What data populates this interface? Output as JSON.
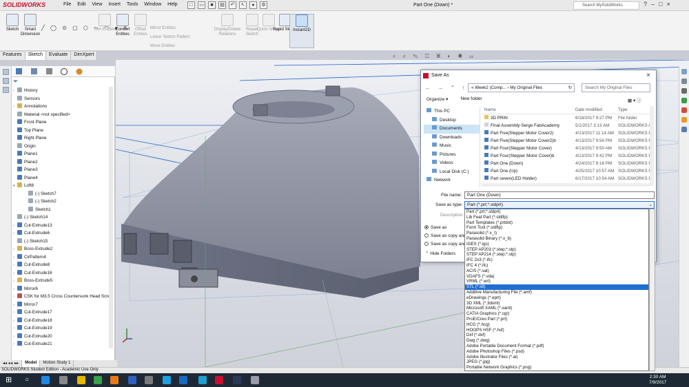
{
  "app": {
    "logo": "SOLIDWORKS",
    "menu": [
      "File",
      "Edit",
      "View",
      "Insert",
      "Tools",
      "Window",
      "Help"
    ],
    "document_title": "Part One (Down) *",
    "search_placeholder": "Search MySolidWorks"
  },
  "ribbon": {
    "tools": [
      {
        "label": "Sketch",
        "dim": false
      },
      {
        "label": "Smart Dimension",
        "dim": false
      },
      {
        "label": "Trim Entities",
        "dim": true
      },
      {
        "label": "Convert Entities",
        "dim": false
      },
      {
        "label": "Offset Entities",
        "dim": true
      },
      {
        "label": "Display/Delete Relations",
        "dim": true
      },
      {
        "label": "Repair Sketch",
        "dim": true
      },
      {
        "label": "Quick Snaps",
        "dim": true
      },
      {
        "label": "Rapid Sketch",
        "dim": false
      },
      {
        "label": "Instant2D",
        "dim": false
      }
    ],
    "mirror": "Mirror Entities",
    "linear": "Linear Sketch Pattern",
    "move": "Move Entities"
  },
  "command_tabs": [
    "Features",
    "Sketch",
    "Evaluate",
    "DimXpert"
  ],
  "tree": [
    {
      "label": "History",
      "icon": "gray"
    },
    {
      "label": "Sensors",
      "icon": "gray"
    },
    {
      "label": "Annotations",
      "icon": "yel"
    },
    {
      "label": "Material <not specified>",
      "icon": "gray"
    },
    {
      "label": "Front Plane",
      "icon": "blue"
    },
    {
      "label": "Top Plane",
      "icon": "blue"
    },
    {
      "label": "Right Plane",
      "icon": "blue"
    },
    {
      "label": "Origin",
      "icon": "gray"
    },
    {
      "label": "Plane1",
      "icon": "blue"
    },
    {
      "label": "Plane2",
      "icon": "blue"
    },
    {
      "label": "Plane3",
      "icon": "blue"
    },
    {
      "label": "Plane4",
      "icon": "blue"
    },
    {
      "label": "Loft8",
      "icon": "yel"
    },
    {
      "label": "(-) Sketch7",
      "icon": "gray"
    },
    {
      "label": "(-) Sketch2",
      "icon": "gray"
    },
    {
      "label": "Sketch1",
      "icon": "gray"
    },
    {
      "label": "(-) Sketch14",
      "icon": "gray"
    },
    {
      "label": "Cut-Extrude13",
      "icon": "blue"
    },
    {
      "label": "Cut-Extrude6",
      "icon": "blue"
    },
    {
      "label": "(-) Sketch15",
      "icon": "gray"
    },
    {
      "label": "Boss-Extrude2",
      "icon": "yel"
    },
    {
      "label": "CirPattern4",
      "icon": "blue"
    },
    {
      "label": "Cut-Extrude8",
      "icon": "blue"
    },
    {
      "label": "Cut-Extrude16",
      "icon": "blue"
    },
    {
      "label": "Boss-Extrude5",
      "icon": "yel"
    },
    {
      "label": "Mirror6",
      "icon": "blue"
    },
    {
      "label": "CSK for M3.5 Cross Countersunk Head Scre",
      "icon": "red"
    },
    {
      "label": "Mirror7",
      "icon": "blue"
    },
    {
      "label": "Cut-Extrude17",
      "icon": "blue"
    },
    {
      "label": "Cut-Extrude18",
      "icon": "blue"
    },
    {
      "label": "Cut-Extrude19",
      "icon": "blue"
    },
    {
      "label": "Cut-Extrude20",
      "icon": "blue"
    },
    {
      "label": "Cut-Extrude21",
      "icon": "blue"
    }
  ],
  "bottom_tabs": [
    "Model",
    "Motion Study 1"
  ],
  "status": "SOLIDWORKS Student Edition - Academic Use Only",
  "dialog": {
    "title": "Save As",
    "address": [
      "«",
      "Week2 (Comp...",
      "My Original Files"
    ],
    "search_placeholder": "Search My Original Files",
    "organize": "Organize ▾",
    "new_folder": "New folder",
    "nav": [
      {
        "label": "This PC",
        "selected": false
      },
      {
        "label": "Desktop",
        "selected": false
      },
      {
        "label": "Documents",
        "selected": true
      },
      {
        "label": "Downloads",
        "selected": false
      },
      {
        "label": "Music",
        "selected": false
      },
      {
        "label": "Pictures",
        "selected": false
      },
      {
        "label": "Videos",
        "selected": false
      },
      {
        "label": "Local Disk (C:)",
        "selected": false
      },
      {
        "label": "Network",
        "selected": false
      }
    ],
    "columns": [
      "Name",
      "Date modified",
      "Type"
    ],
    "files": [
      {
        "name": "3D PRIN",
        "date": "6/18/2017 9:27 PM",
        "type": "File folder",
        "kind": "fold"
      },
      {
        "name": "Final Assembly-Serge FabAcademy",
        "date": "5/1/2017 3:13 AM",
        "type": "SOLIDWORKS As",
        "kind": "doc"
      },
      {
        "name": "Part Five(Stepper Motor Cover2)",
        "date": "4/13/2017 11:14 AM",
        "type": "SOLIDWORKS Pa",
        "kind": "part"
      },
      {
        "name": "Part Five(Stepper Motor Cover2)b",
        "date": "4/13/2017 9:56 PM",
        "type": "SOLIDWORKS Pa",
        "kind": "part"
      },
      {
        "name": "Part Four(Stepper Motor Cover)",
        "date": "4/13/2017 9:50 AM",
        "type": "SOLIDWORKS Pa",
        "kind": "part"
      },
      {
        "name": "Part Four(Stepper Motor Cover)b",
        "date": "4/13/2017 9:42 PM",
        "type": "SOLIDWORKS Pa",
        "kind": "part"
      },
      {
        "name": "Part One (Down)",
        "date": "4/24/2017 8:16 PM",
        "type": "SOLIDWORKS Pa",
        "kind": "part"
      },
      {
        "name": "Part One (Up)",
        "date": "4/25/2017 10:57 AM",
        "type": "SOLIDWORKS Pa",
        "kind": "part"
      },
      {
        "name": "Part seven(LED Holder)",
        "date": "6/17/2017 10:54 AM",
        "type": "SOLIDWORKS Pa",
        "kind": "part"
      }
    ],
    "file_name_label": "File name:",
    "file_name": "Part One (Down)",
    "save_type_label": "Save as type:",
    "save_type": "Part (*.prt;*.sldprt)",
    "description_label": "Description:",
    "radios": [
      "Save as",
      "Save as copy and c",
      "Save as copy and o"
    ],
    "hide_folders": "Hide Folders"
  },
  "file_types": [
    "Part (*.prt;*.sldprt)",
    "Lib Feat Part (*.sldlfp)",
    "Part Templates (*.prtdot)",
    "Form Tool (*.sldftp)",
    "Parasolid (*.x_t)",
    "Parasolid Binary (*.x_b)",
    "IGES (*.igs)",
    "STEP AP203 (*.step;*.stp)",
    "STEP AP214 (*.step;*.stp)",
    "IFC 2x3 (*.ifc)",
    "IFC 4 (*.ifc)",
    "ACIS (*.sat)",
    "VDAFS (*.vda)",
    "VRML (*.wrl)",
    "STL (*.stl)",
    "Additive Manufacturing File (*.amf)",
    "eDrawings (*.eprt)",
    "3D XML (*.3dxml)",
    "Microsoft XAML (*.xaml)",
    "CATIA Graphics (*.cgr)",
    "ProE/Creo Part (*.prt)",
    "HCG (*.hcg)",
    "HOOPS HSF (*.hsf)",
    "Dxf (*.dxf)",
    "Dwg (*.dwg)",
    "Adobe Portable Document Format (*.pdf)",
    "Adobe Photoshop Files (*.psd)",
    "Adobe Illustrator Files (*.ai)",
    "JPEG (*.jpg)",
    "Portable Network Graphics (*.png)"
  ],
  "selected_file_type": "STL (*.stl)",
  "taskbar": {
    "time": "2:30 AM",
    "date": "7/9/2017"
  },
  "colors": {
    "accent": "#1f6fd1",
    "brand": "#c8102e",
    "model": "#7f8496"
  }
}
